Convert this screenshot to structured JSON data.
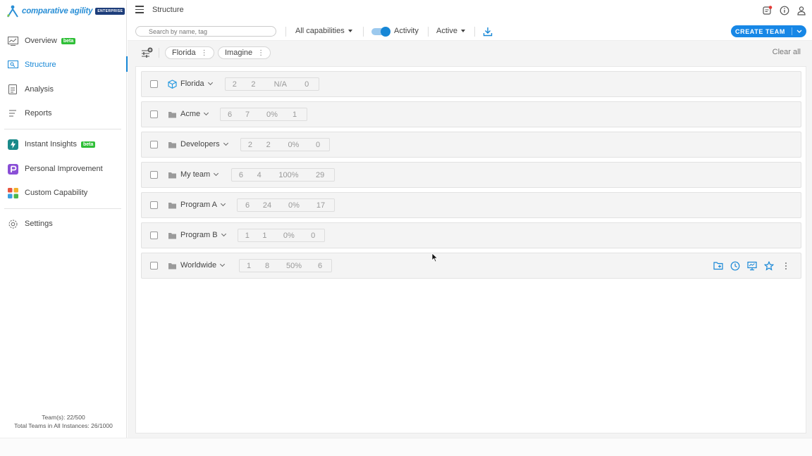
{
  "brand": {
    "name": "comparative agility",
    "badge": "ENTERPRISE",
    "accent": "#1787d6"
  },
  "sidebar": {
    "items": [
      {
        "label": "Overview",
        "icon": "chart-icon",
        "badge": "beta"
      },
      {
        "label": "Structure",
        "icon": "structure-icon",
        "active": true
      },
      {
        "label": "Analysis",
        "icon": "document-icon"
      },
      {
        "label": "Reports",
        "icon": "list-icon"
      },
      {
        "label": "Instant Insights",
        "icon": "lightning-icon",
        "badge": "beta"
      },
      {
        "label": "Personal Improvement",
        "icon": "personal-improvement-icon"
      },
      {
        "label": "Custom Capability",
        "icon": "grid-icon"
      },
      {
        "label": "Settings",
        "icon": "gear-icon"
      }
    ],
    "stats": {
      "teams": "Team(s): 22/500",
      "total": "Total Teams in All Instances: 26/1000"
    }
  },
  "header": {
    "title": "Structure"
  },
  "toolbar": {
    "search_placeholder": "Search by name, tag",
    "capabilities": "All capabilities",
    "activity_label": "Activity",
    "activity_on": true,
    "status": "Active",
    "create_label": "CREATE TEAM"
  },
  "filters": {
    "chips": [
      "Florida",
      "Imagine"
    ],
    "clear_label": "Clear all"
  },
  "teams": [
    {
      "name": "Florida",
      "icon": "cube-icon",
      "stats": [
        "2",
        "2",
        "N/A",
        "0"
      ]
    },
    {
      "name": "Acme",
      "icon": "folder-icon",
      "stats": [
        "6",
        "7",
        "0%",
        "1"
      ]
    },
    {
      "name": "Developers",
      "icon": "folder-icon",
      "stats": [
        "2",
        "2",
        "0%",
        "0"
      ]
    },
    {
      "name": "My team",
      "icon": "folder-icon",
      "stats": [
        "6",
        "4",
        "100%",
        "29"
      ]
    },
    {
      "name": "Program A",
      "icon": "folder-icon",
      "stats": [
        "6",
        "24",
        "0%",
        "17"
      ]
    },
    {
      "name": "Program B",
      "icon": "folder-icon",
      "stats": [
        "1",
        "1",
        "0%",
        "0"
      ]
    },
    {
      "name": "Worldwide",
      "icon": "folder-icon",
      "stats": [
        "1",
        "8",
        "50%",
        "6"
      ],
      "hovered": true
    }
  ]
}
